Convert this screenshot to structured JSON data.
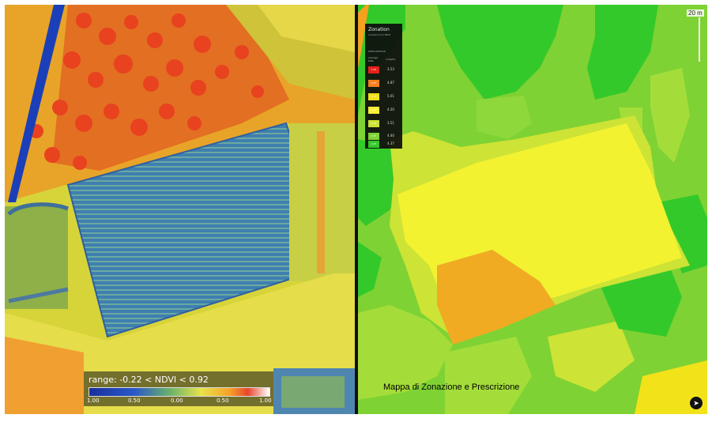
{
  "ndvi_panel": {
    "legend": {
      "range_text": "range: -0.22 < NDVI < 0.92",
      "ticks": [
        "1.00",
        "0.50",
        "0.00",
        "0.50",
        "1.00"
      ]
    }
  },
  "zonation_panel": {
    "legend": {
      "title": "Zonation",
      "subtitle": "Created from NDVI",
      "header": "PRESCRIPTION",
      "col1": "average",
      "col1b": "Rate",
      "col2": "units/ha",
      "rows": [
        {
          "label": "1.00",
          "value": "3.53",
          "color": "#e5201a"
        },
        {
          "label": "0.87",
          "value": "4.87",
          "color": "#f4801e"
        },
        {
          "label": "0.75",
          "value": "5.01",
          "color": "#f2e21a"
        },
        {
          "label": "0.62",
          "value": "4.20",
          "color": "#f8ef35"
        },
        {
          "label": "0.50",
          "value": "3.51",
          "color": "#cde335"
        },
        {
          "label": "0.37",
          "value": "4.40",
          "color": "#7fd233"
        },
        {
          "label": "0.25",
          "value": "4.37",
          "color": "#34c92a"
        }
      ]
    },
    "caption": "Mappa di Zonazione e Prescrizione",
    "scale_label": "20 m",
    "compass_icon": "compass-icon"
  }
}
